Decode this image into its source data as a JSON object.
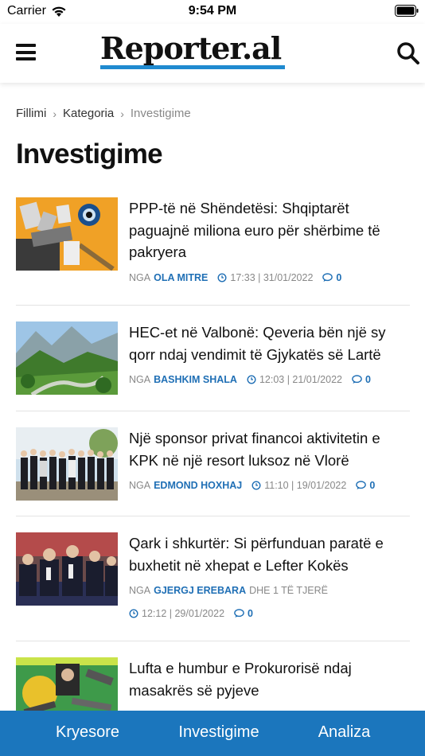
{
  "status_bar": {
    "carrier": "Carrier",
    "time": "9:54 PM"
  },
  "header": {
    "logo_text": "Reporter.al",
    "menu_icon": "hamburger-menu-icon",
    "search_icon": "search-icon",
    "accent_color": "#1f8ad0"
  },
  "breadcrumb": {
    "items": [
      "Fillimi",
      "Kategoria",
      "Investigime"
    ]
  },
  "page_title": "Investigime",
  "articles": [
    {
      "title": "PPP-të në Shëndetësi: Shqiptarët paguajnë miliona euro për shërbime të pakryera",
      "by": "NGA",
      "author": "OLA MITRE",
      "extra": "",
      "time": "17:33 | 31/01/2022",
      "comments": "0"
    },
    {
      "title": "HEC-et në Valbonë: Qeveria bën një sy qorr ndaj vendimit të Gjykatës së Lartë",
      "by": "NGA",
      "author": "BASHKIM SHALA",
      "extra": "",
      "time": "12:03 | 21/01/2022",
      "comments": "0"
    },
    {
      "title": "Një sponsor privat financoi aktivitetin e KPK në një resort luksoz në Vlorë",
      "by": "NGA",
      "author": "EDMOND HOXHAJ",
      "extra": "",
      "time": "11:10 | 19/01/2022",
      "comments": "0"
    },
    {
      "title": "Qark i shkurtër: Si përfunduan paratë e buxhetit në xhepat e Lefter Kokës",
      "by": "NGA",
      "author": "GJERGJ EREBARA",
      "extra": "DHE 1 TË TJERË",
      "time": "12:12 | 29/01/2022",
      "comments": "0"
    },
    {
      "title": "Lufta e humbur e Prokurorisë ndaj masakrës së pyjeve"
    }
  ],
  "bottom_tabs": [
    "Kryesore",
    "Investigime",
    "Analiza"
  ],
  "tab_bar_color": "#1b76bd"
}
